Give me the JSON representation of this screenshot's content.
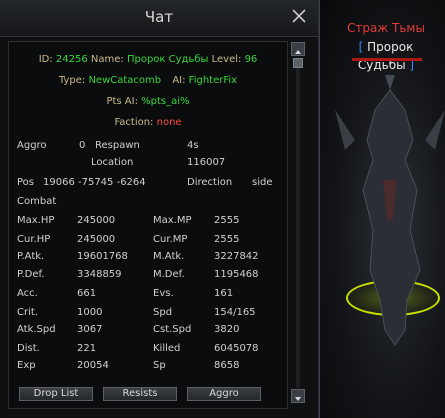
{
  "window": {
    "title": "Чат"
  },
  "header": {
    "id_label": "ID:",
    "id_value": "24256",
    "name_label": "Name:",
    "name_value": "Пророк Судьбы",
    "level_label": "Level:",
    "level_value": "96",
    "type_label": "Type:",
    "type_value": "NewCatacomb",
    "ai_label": "AI:",
    "ai_value": "FighterFix",
    "pts_ai_label": "Pts AI:",
    "pts_ai_value": "%pts_ai%",
    "faction_label": "Faction:",
    "faction_value": "none"
  },
  "info": {
    "aggro_label": "Aggro",
    "aggro_value": "0",
    "respawn_label": "Respawn",
    "respawn_value": "4s",
    "location_label": "Location",
    "location_value": "116007",
    "pos_label": "Pos",
    "pos_value": "19066 -75745 -6264",
    "direction_label": "Direction",
    "direction_value": "side"
  },
  "combat": {
    "section_label": "Combat",
    "stats": [
      {
        "l1": "Max.HP",
        "v1": "245000",
        "l2": "Max.MP",
        "v2": "2555"
      },
      {
        "l1": "Cur.HP",
        "v1": "245000",
        "l2": "Cur.MP",
        "v2": "2555"
      },
      {
        "l1": "P.Atk.",
        "v1": "19601768",
        "l2": "M.Atk.",
        "v2": "3227842"
      },
      {
        "l1": "P.Def.",
        "v1": "3348859",
        "l2": "M.Def.",
        "v2": "1195468"
      },
      {
        "l1": "Acc.",
        "v1": "661",
        "l2": "Evs.",
        "v2": "161"
      },
      {
        "l1": "Crit.",
        "v1": "1000",
        "l2": "Spd",
        "v2": "154/165"
      },
      {
        "l1": "Atk.Spd",
        "v1": "3067",
        "l2": "Cst.Spd",
        "v2": "3820"
      },
      {
        "l1": "Dist.",
        "v1": "221",
        "l2": "Killed",
        "v2": "6045078"
      },
      {
        "l1": "Exp",
        "v1": "20054",
        "l2": "Sp",
        "v2": "8658"
      }
    ]
  },
  "buttons": {
    "drop_list": "Drop List",
    "resists": "Resists",
    "aggro": "Aggro"
  },
  "npc": {
    "title": "Страж Тьмы",
    "name": "Пророк Судьбы"
  },
  "colors": {
    "label": "#c9b98a",
    "value": "#39d63a",
    "faction": "#ff4b3a",
    "combat": "#e7a33c",
    "npc_title": "#e23b3b",
    "ground_ring": "#c8e000"
  }
}
